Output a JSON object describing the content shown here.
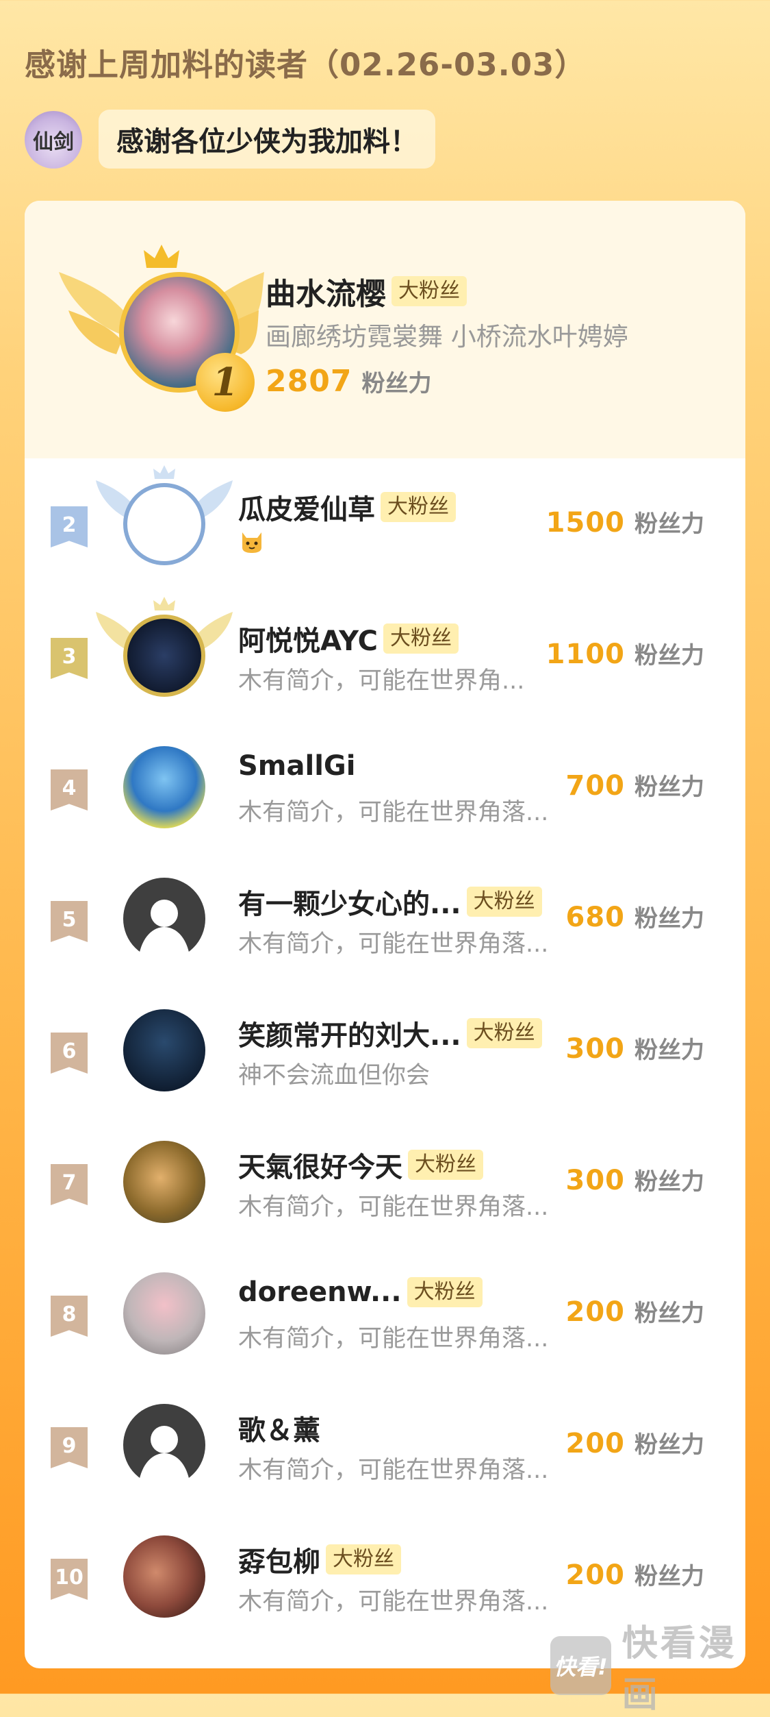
{
  "header": {
    "title": "感谢上周加料的读者（02.26-03.03）",
    "greeting": "感谢各位少侠为我加料！",
    "logo_text": "仙剑"
  },
  "score_unit": "粉丝力",
  "badge_label": "大粉丝",
  "top": {
    "rank": "1",
    "name": "曲水流樱",
    "badge": "大粉丝",
    "bio": "画廊绣坊霓裳舞 小桥流水叶娉婷",
    "score": "2807",
    "unit": "粉丝力"
  },
  "rows": [
    {
      "rank": "2",
      "name": "瓜皮爱仙草",
      "badge": "大粉丝",
      "bio": "",
      "emoji": "cat-emoji",
      "score": "1500",
      "unit": "粉丝力"
    },
    {
      "rank": "3",
      "name": "阿悦悦AYC",
      "badge": "大粉丝",
      "bio": "木有简介，可能在世界角...",
      "score": "1100",
      "unit": "粉丝力"
    },
    {
      "rank": "4",
      "name": "SmallGi",
      "badge": "",
      "bio": "木有简介，可能在世界角落...",
      "score": "700",
      "unit": "粉丝力"
    },
    {
      "rank": "5",
      "name": "有一颗少女心的...",
      "badge": "大粉丝",
      "bio": "木有简介，可能在世界角落...",
      "score": "680",
      "unit": "粉丝力"
    },
    {
      "rank": "6",
      "name": "笑颜常开的刘大...",
      "badge": "大粉丝",
      "bio": "神不会流血但你会",
      "score": "300",
      "unit": "粉丝力"
    },
    {
      "rank": "7",
      "name": "天氣很好今天",
      "badge": "大粉丝",
      "bio": "木有简介，可能在世界角落...",
      "score": "300",
      "unit": "粉丝力"
    },
    {
      "rank": "8",
      "name": "doreenw...",
      "badge": "大粉丝",
      "bio": "木有简介，可能在世界角落...",
      "score": "200",
      "unit": "粉丝力"
    },
    {
      "rank": "9",
      "name": "歌＆薰",
      "badge": "",
      "bio": "木有简介，可能在世界角落...",
      "score": "200",
      "unit": "粉丝力"
    },
    {
      "rank": "10",
      "name": "孬包柳",
      "badge": "大粉丝",
      "bio": "木有简介，可能在世界角落...",
      "score": "200",
      "unit": "粉丝力"
    }
  ],
  "rank_colors": {
    "2": "#A9C3E6",
    "3": "#D9C36E",
    "default": "#D2B59C"
  },
  "watermark": {
    "logo": "快看!",
    "text": "快看漫画"
  }
}
